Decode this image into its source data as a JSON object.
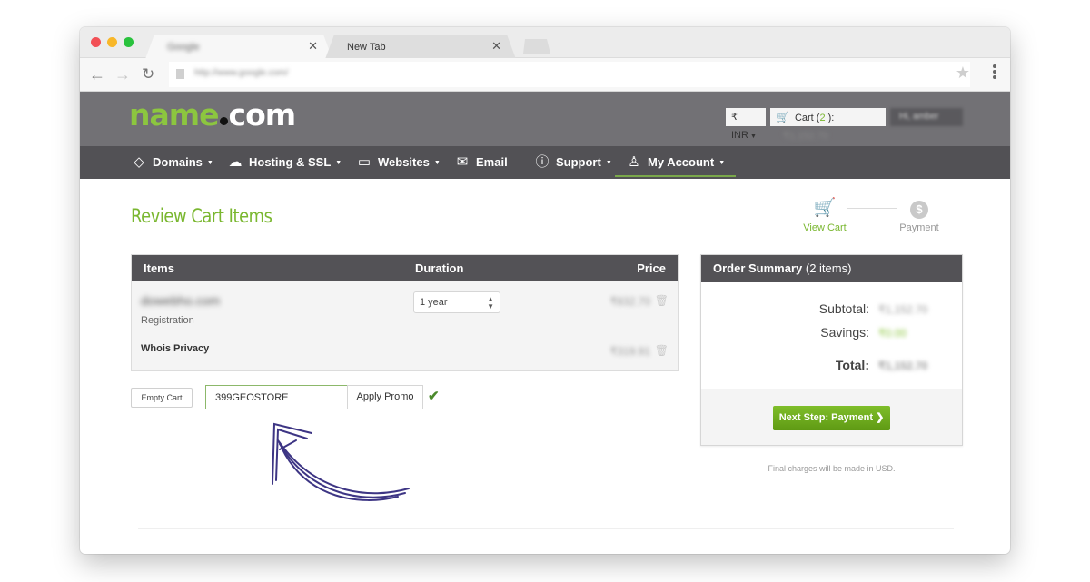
{
  "browser": {
    "tabs": [
      {
        "title": "Google",
        "active": true
      },
      {
        "title": "New Tab",
        "active": false
      }
    ],
    "tab_close_glyph": "✕",
    "address": "http://www.google.com/",
    "nav": {
      "back": "←",
      "forward": "→",
      "reload": "↻"
    },
    "star_glyph": "★"
  },
  "header": {
    "logo_green": "name",
    "logo_white": "com",
    "currency": "₹ INR",
    "cart_label": "Cart (",
    "cart_count": "2",
    "cart_suffix": " ):",
    "cart_amount": "₹1,152.70",
    "account": "Hi, amber"
  },
  "nav": {
    "items": [
      {
        "label": "Domains",
        "icon": "tag-icon",
        "glyph": "⌂",
        "dropdown": true
      },
      {
        "label": "Hosting & SSL",
        "icon": "cloud-upload-icon",
        "glyph": "☁",
        "dropdown": true
      },
      {
        "label": "Websites",
        "icon": "monitor-icon",
        "glyph": "▭",
        "dropdown": true
      },
      {
        "label": "Email",
        "icon": "envelope-icon",
        "glyph": "✉",
        "dropdown": false
      },
      {
        "label": "Support",
        "icon": "info-icon",
        "glyph": "ⓘ",
        "dropdown": true
      },
      {
        "label": "My Account",
        "icon": "user-icon",
        "glyph": "♙",
        "dropdown": true,
        "active": true
      }
    ],
    "caret": "▼"
  },
  "page": {
    "title": "Review Cart Items",
    "steps": [
      {
        "label": "View Cart",
        "icon": "cart-icon",
        "glyph": "🛒",
        "active": true
      },
      {
        "label": "Payment",
        "icon": "dollar-icon",
        "glyph": "$",
        "active": false
      }
    ]
  },
  "cart": {
    "headers": {
      "items": "Items",
      "duration": "Duration",
      "price": "Price"
    },
    "rows": [
      {
        "name": "dowebho.com",
        "sub": "Registration",
        "duration": "1 year",
        "price": "₹832.70"
      },
      {
        "name": "Whois Privacy",
        "sub": "",
        "duration": "",
        "price": "₹319.91"
      }
    ],
    "trash_glyph": "🗑",
    "empty_cart": "Empty Cart",
    "promo_value": "399GEOSTORE",
    "apply_promo": "Apply Promo",
    "check_glyph": "✔"
  },
  "summary": {
    "title_bold": "Order Summary",
    "title_count": " (2 items)",
    "subtotal_label": "Subtotal:",
    "subtotal_value": "₹1,152.70",
    "savings_label": "Savings:",
    "savings_value": "₹0.00",
    "total_label": "Total:",
    "total_value": "₹1,152.70",
    "next_button": "Next Step: Payment ❯",
    "note": "Final charges will be made in USD."
  },
  "annotation": {
    "color": "#3d3584"
  },
  "colors": {
    "brand_green": "#8cc63f",
    "header_gray": "#727175",
    "nav_dark": "#525155"
  }
}
